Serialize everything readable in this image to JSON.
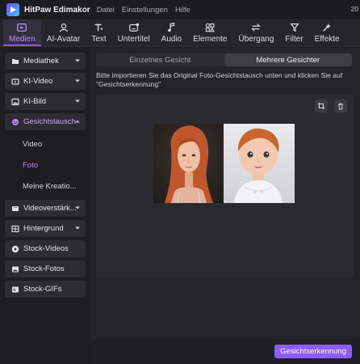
{
  "app": {
    "title": "HitPaw Edimakor",
    "menu": [
      "Datei",
      "Einstellungen",
      "Hilfe"
    ],
    "right_text": "20"
  },
  "toolbar": {
    "tools": [
      {
        "label": "Medien",
        "icon": "media-icon",
        "active": true
      },
      {
        "label": "AI-Avatar",
        "icon": "avatar-icon"
      },
      {
        "label": "Text",
        "icon": "text-icon"
      },
      {
        "label": "Untertitel",
        "icon": "subtitle-icon"
      },
      {
        "label": "Audio",
        "icon": "music-note-icon"
      },
      {
        "label": "Elemente",
        "icon": "elements-icon"
      },
      {
        "label": "Übergang",
        "icon": "transition-icon"
      },
      {
        "label": "Filter",
        "icon": "filter-icon"
      },
      {
        "label": "Effekte",
        "icon": "effects-icon"
      }
    ]
  },
  "sidebar": {
    "items": [
      {
        "label": "Mediathek",
        "icon": "folder-icon"
      },
      {
        "label": "KI-Video",
        "icon": "ai-video-icon"
      },
      {
        "label": "KI-Bild",
        "icon": "ai-image-icon"
      },
      {
        "label": "Gesichtstausch",
        "icon": "face-swap-icon"
      }
    ],
    "subitems": [
      {
        "label": "Video"
      },
      {
        "label": "Foto",
        "active": true
      },
      {
        "label": "Meine Kreatio..."
      }
    ],
    "items2": [
      {
        "label": "Videoverstärk...",
        "icon": "enhance-icon"
      },
      {
        "label": "Hintergrund",
        "icon": "background-icon"
      },
      {
        "label": "Stock-Videos",
        "icon": "play-icon"
      },
      {
        "label": "Stock-Fotos",
        "icon": "photo-icon"
      },
      {
        "label": "Stock-GIFs",
        "icon": "gif-icon"
      }
    ]
  },
  "main": {
    "tabs": [
      "Einzelnes Gesicht",
      "Mehrere Gesichter"
    ],
    "active_tab": "Mehrere Gesichter",
    "hint": "Bitte importieren Sie das Original Foto-Gesichtstausch unten und klicken Sie auf \"Gesichtserkennung\"",
    "detect_button": "Gesichtserkennung"
  },
  "colors": {
    "accent": "#8f5cf7",
    "active_text": "#b58cff"
  }
}
